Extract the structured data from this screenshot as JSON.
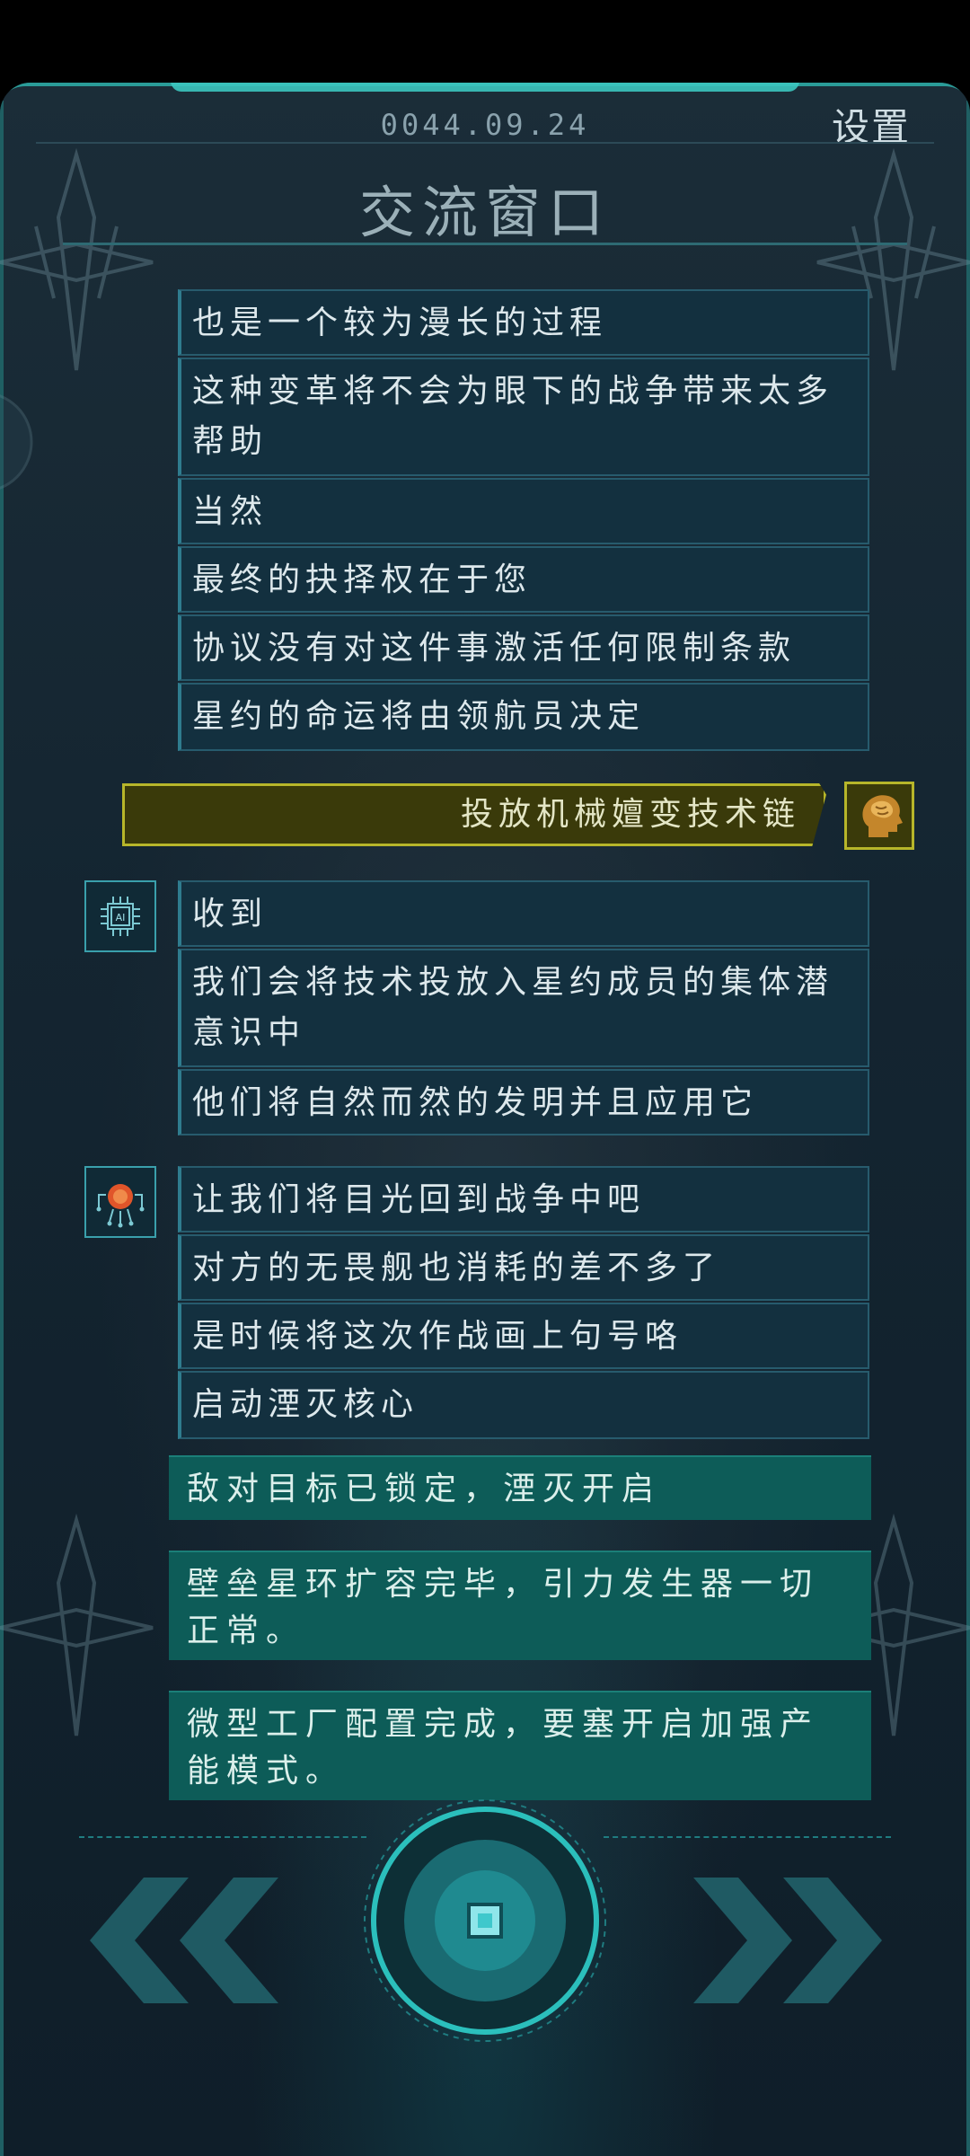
{
  "header": {
    "date": "0044.09.24",
    "settings_label": "设置",
    "title": "交流窗口"
  },
  "messages_before": [
    "也是一个较为漫长的过程",
    "这种变革将不会为眼下的战争带来太多帮助",
    "当然",
    "最终的抉择权在于您",
    "协议没有对这件事激活任何限制条款",
    "星约的命运将由领航员决定"
  ],
  "player_choice": "投放机械嬗变技术链",
  "ai_group": [
    "收到",
    "我们会将技术投放入星约成员的集体潜意识中",
    "他们将自然而然的发明并且应用它"
  ],
  "commander_group": [
    "让我们将目光回到战争中吧",
    "对方的无畏舰也消耗的差不多了",
    "是时候将这次作战画上句号咯",
    "启动湮灭核心"
  ],
  "system_notices": [
    "敌对目标已锁定，湮灭开启",
    "壁垒星环扩容完毕，引力发生器一切正常。",
    "微型工厂配置完成，要塞开启加强产能模式。"
  ],
  "avatar_labels": {
    "ai": "AI"
  },
  "colors": {
    "accent_teal": "#2a9c98",
    "player_border": "#b7b62a",
    "message_bg": "#13303f",
    "system_bg": "#0d5c58"
  },
  "icons": {
    "player": "brain-head-icon",
    "ai": "ai-chip-icon",
    "commander": "circuit-head-icon",
    "prev": "double-chevron-left-icon",
    "next": "double-chevron-right-icon",
    "center": "core-button-icon"
  }
}
